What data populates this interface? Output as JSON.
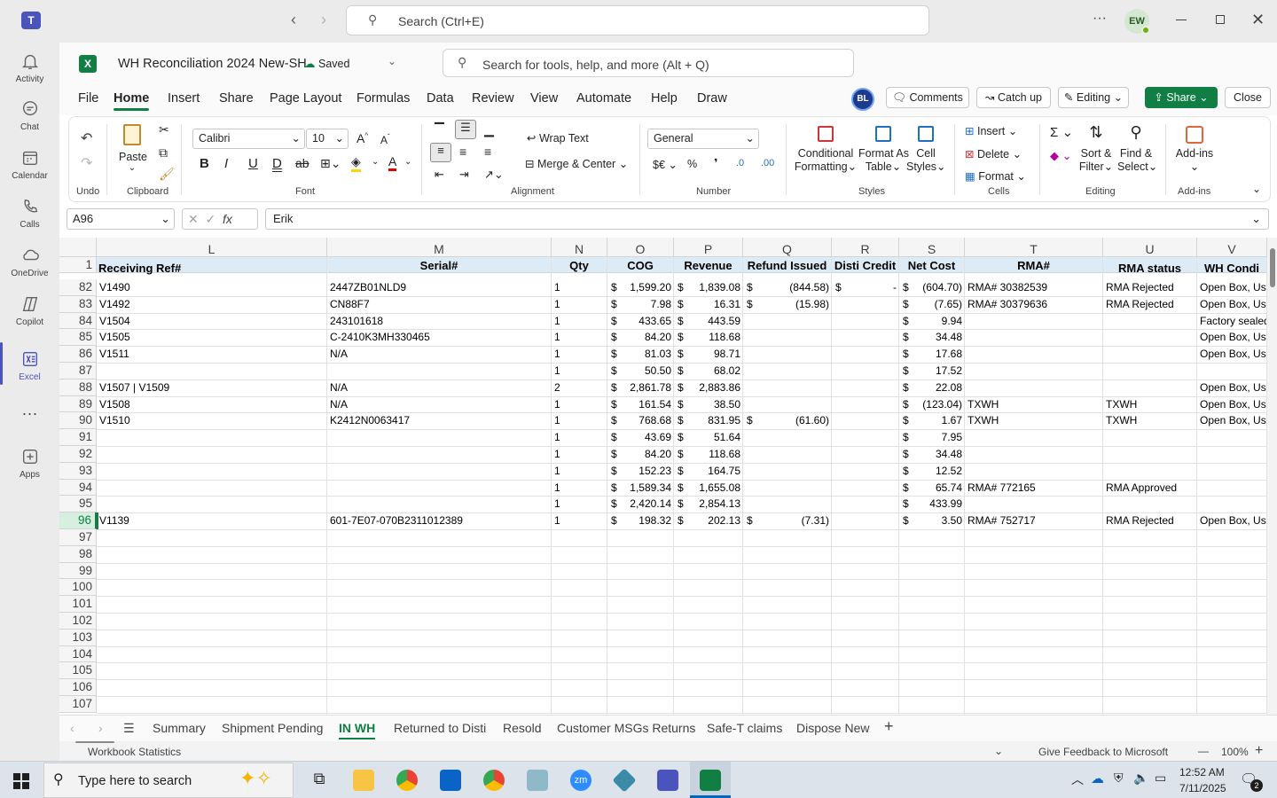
{
  "teams": {
    "search_placeholder": "Search (Ctrl+E)",
    "more": "···",
    "avatar": "EW"
  },
  "rail": [
    {
      "label": "Activity",
      "icon": "bell-icon"
    },
    {
      "label": "Chat",
      "icon": "chat-icon"
    },
    {
      "label": "Calendar",
      "icon": "calendar-icon"
    },
    {
      "label": "Calls",
      "icon": "phone-icon"
    },
    {
      "label": "OneDrive",
      "icon": "cloud-icon"
    },
    {
      "label": "Copilot",
      "icon": "copilot-icon"
    },
    {
      "label": "Excel",
      "icon": "excel-icon"
    },
    {
      "label": "···",
      "icon": "more-icon"
    },
    {
      "label": "Apps",
      "icon": "apps-icon"
    }
  ],
  "workbook": {
    "title": "WH Reconciliation 2024 New-SH",
    "saved": "Saved",
    "search_placeholder": "Search for tools, help, and more (Alt + Q)",
    "user_badge": "BL"
  },
  "menu_tabs": [
    "File",
    "Home",
    "Insert",
    "Share",
    "Page Layout",
    "Formulas",
    "Data",
    "Review",
    "View",
    "Automate",
    "Help",
    "Draw"
  ],
  "top_actions": {
    "comments": "Comments",
    "catchup": "Catch up",
    "editing": "Editing",
    "share": "Share",
    "close": "Close"
  },
  "ribbon": {
    "undo": "Undo",
    "paste": "Paste",
    "clipboard": "Clipboard",
    "font_name": "Calibri",
    "font_size": "10",
    "font_group": "Font",
    "wrap_text": "Wrap Text",
    "merge_center": "Merge & Center",
    "alignment_group": "Alignment",
    "number_format": "General",
    "number_group": "Number",
    "conditional_1": "Conditional",
    "conditional_2": "Formatting",
    "format_table_1": "Format As",
    "format_table_2": "Table",
    "cell_styles_1": "Cell",
    "cell_styles_2": "Styles",
    "styles_group": "Styles",
    "insert": "Insert",
    "delete": "Delete",
    "format": "Format",
    "cells_group": "Cells",
    "sort_1": "Sort &",
    "sort_2": "Filter",
    "find_1": "Find &",
    "find_2": "Select",
    "editing_group": "Editing",
    "addins": "Add-ins",
    "addins_group": "Add-ins",
    "currency": "$€",
    "percent": "%",
    "comma": "❜"
  },
  "formula_bar": {
    "name_box": "A96",
    "fx": "fx",
    "value": "Erik"
  },
  "columns": [
    {
      "letter": "L",
      "header": "Receiving Ref#"
    },
    {
      "letter": "M",
      "header": "Serial#"
    },
    {
      "letter": "N",
      "header": "Qty"
    },
    {
      "letter": "O",
      "header": "COG"
    },
    {
      "letter": "P",
      "header": "Revenue"
    },
    {
      "letter": "Q",
      "header": "Refund Issued"
    },
    {
      "letter": "R",
      "header": "Disti Credit"
    },
    {
      "letter": "S",
      "header": "Net Cost"
    },
    {
      "letter": "T",
      "header": "RMA#"
    },
    {
      "letter": "U",
      "header": "RMA status"
    },
    {
      "letter": "V",
      "header": "WH Condi"
    }
  ],
  "header_row_number": "1",
  "rows": [
    {
      "n": "82",
      "ref": "V1490",
      "serial": "2447ZB01NLD9",
      "qty": "1",
      "cog": "1,599.20",
      "rev": "1,839.08",
      "refund": "(844.58)",
      "disti": "-",
      "net": "(604.70)",
      "rma": "RMA# 30382539",
      "status": "RMA Rejected",
      "cond": "Open Box, Use"
    },
    {
      "n": "83",
      "ref": "V1492",
      "serial": "CN88F7",
      "qty": "1",
      "cog": "7.98",
      "rev": "16.31",
      "refund": "(15.98)",
      "disti": "",
      "net": "(7.65)",
      "rma": "RMA# 30379636",
      "status": "RMA Rejected",
      "cond": "Open Box, Use"
    },
    {
      "n": "84",
      "ref": "V1504",
      "serial": "243101618",
      "qty": "1",
      "cog": "433.65",
      "rev": "443.59",
      "refund": "",
      "disti": "",
      "net": "9.94",
      "rma": "",
      "status": "",
      "cond": "Factory sealed"
    },
    {
      "n": "85",
      "ref": "V1505",
      "serial": "C-2410K3MH330465",
      "qty": "1",
      "cog": "84.20",
      "rev": "118.68",
      "refund": "",
      "disti": "",
      "net": "34.48",
      "rma": "",
      "status": "",
      "cond": "Open Box, Use"
    },
    {
      "n": "86",
      "ref": "V1511",
      "serial": "N/A",
      "qty": "1",
      "cog": "81.03",
      "rev": "98.71",
      "refund": "",
      "disti": "",
      "net": "17.68",
      "rma": "",
      "status": "",
      "cond": "Open Box, Use"
    },
    {
      "n": "87",
      "ref": "",
      "serial": "",
      "qty": "1",
      "cog": "50.50",
      "rev": "68.02",
      "refund": "",
      "disti": "",
      "net": "17.52",
      "rma": "",
      "status": "",
      "cond": ""
    },
    {
      "n": "88",
      "ref": "V1507 | V1509",
      "serial": "N/A",
      "qty": "2",
      "cog": "2,861.78",
      "rev": "2,883.86",
      "refund": "",
      "disti": "",
      "net": "22.08",
      "rma": "",
      "status": "",
      "cond": "Open Box, Use"
    },
    {
      "n": "89",
      "ref": "V1508",
      "serial": "N/A",
      "qty": "1",
      "cog": "161.54",
      "rev": "38.50",
      "refund": "",
      "disti": "",
      "net": "(123.04)",
      "rma": "TXWH",
      "status": "TXWH",
      "cond": "Open Box, Use"
    },
    {
      "n": "90",
      "ref": "V1510",
      "serial": "K2412N0063417",
      "qty": "1",
      "cog": "768.68",
      "rev": "831.95",
      "refund": "(61.60)",
      "disti": "",
      "net": "1.67",
      "rma": "TXWH",
      "status": "TXWH",
      "cond": "Open Box, Use"
    },
    {
      "n": "91",
      "ref": "",
      "serial": "",
      "qty": "1",
      "cog": "43.69",
      "rev": "51.64",
      "refund": "",
      "disti": "",
      "net": "7.95",
      "rma": "",
      "status": "",
      "cond": ""
    },
    {
      "n": "92",
      "ref": "",
      "serial": "",
      "qty": "1",
      "cog": "84.20",
      "rev": "118.68",
      "refund": "",
      "disti": "",
      "net": "34.48",
      "rma": "",
      "status": "",
      "cond": ""
    },
    {
      "n": "93",
      "ref": "",
      "serial": "",
      "qty": "1",
      "cog": "152.23",
      "rev": "164.75",
      "refund": "",
      "disti": "",
      "net": "12.52",
      "rma": "",
      "status": "",
      "cond": ""
    },
    {
      "n": "94",
      "ref": "",
      "serial": "",
      "qty": "1",
      "cog": "1,589.34",
      "rev": "1,655.08",
      "refund": "",
      "disti": "",
      "net": "65.74",
      "rma": "RMA# 772165",
      "status": "RMA Approved",
      "cond": ""
    },
    {
      "n": "95",
      "ref": "",
      "serial": "",
      "qty": "1",
      "cog": "2,420.14",
      "rev": "2,854.13",
      "refund": "",
      "disti": "",
      "net": "433.99",
      "rma": "",
      "status": "",
      "cond": ""
    },
    {
      "n": "96",
      "ref": "V1139",
      "serial": "601-7E07-070B2311012389",
      "qty": "1",
      "cog": "198.32",
      "rev": "202.13",
      "refund": "(7.31)",
      "disti": "",
      "net": "3.50",
      "rma": "RMA# 752717",
      "status": "RMA Rejected",
      "cond": "Open Box, Use"
    }
  ],
  "empty_rows": [
    "97",
    "98",
    "99",
    "100",
    "101",
    "102",
    "103",
    "104",
    "105",
    "106",
    "107"
  ],
  "currency_symbol": "$",
  "sheet_tabs": [
    "Summary",
    "Shipment Pending",
    "IN WH",
    "Returned to Disti",
    "Resold",
    "Customer MSGs Returns",
    "Safe-T claims",
    "Dispose New"
  ],
  "active_sheet": "IN WH",
  "add_sheet": "+",
  "status_bar": {
    "left": "Workbook Statistics",
    "feedback": "Give Feedback to Microsoft",
    "zoom": "100%",
    "minus": "—",
    "plus": "+"
  },
  "taskbar": {
    "search_placeholder": "Type here to search",
    "time": "12:52 AM",
    "date": "7/11/2025",
    "notif_count": "2"
  }
}
